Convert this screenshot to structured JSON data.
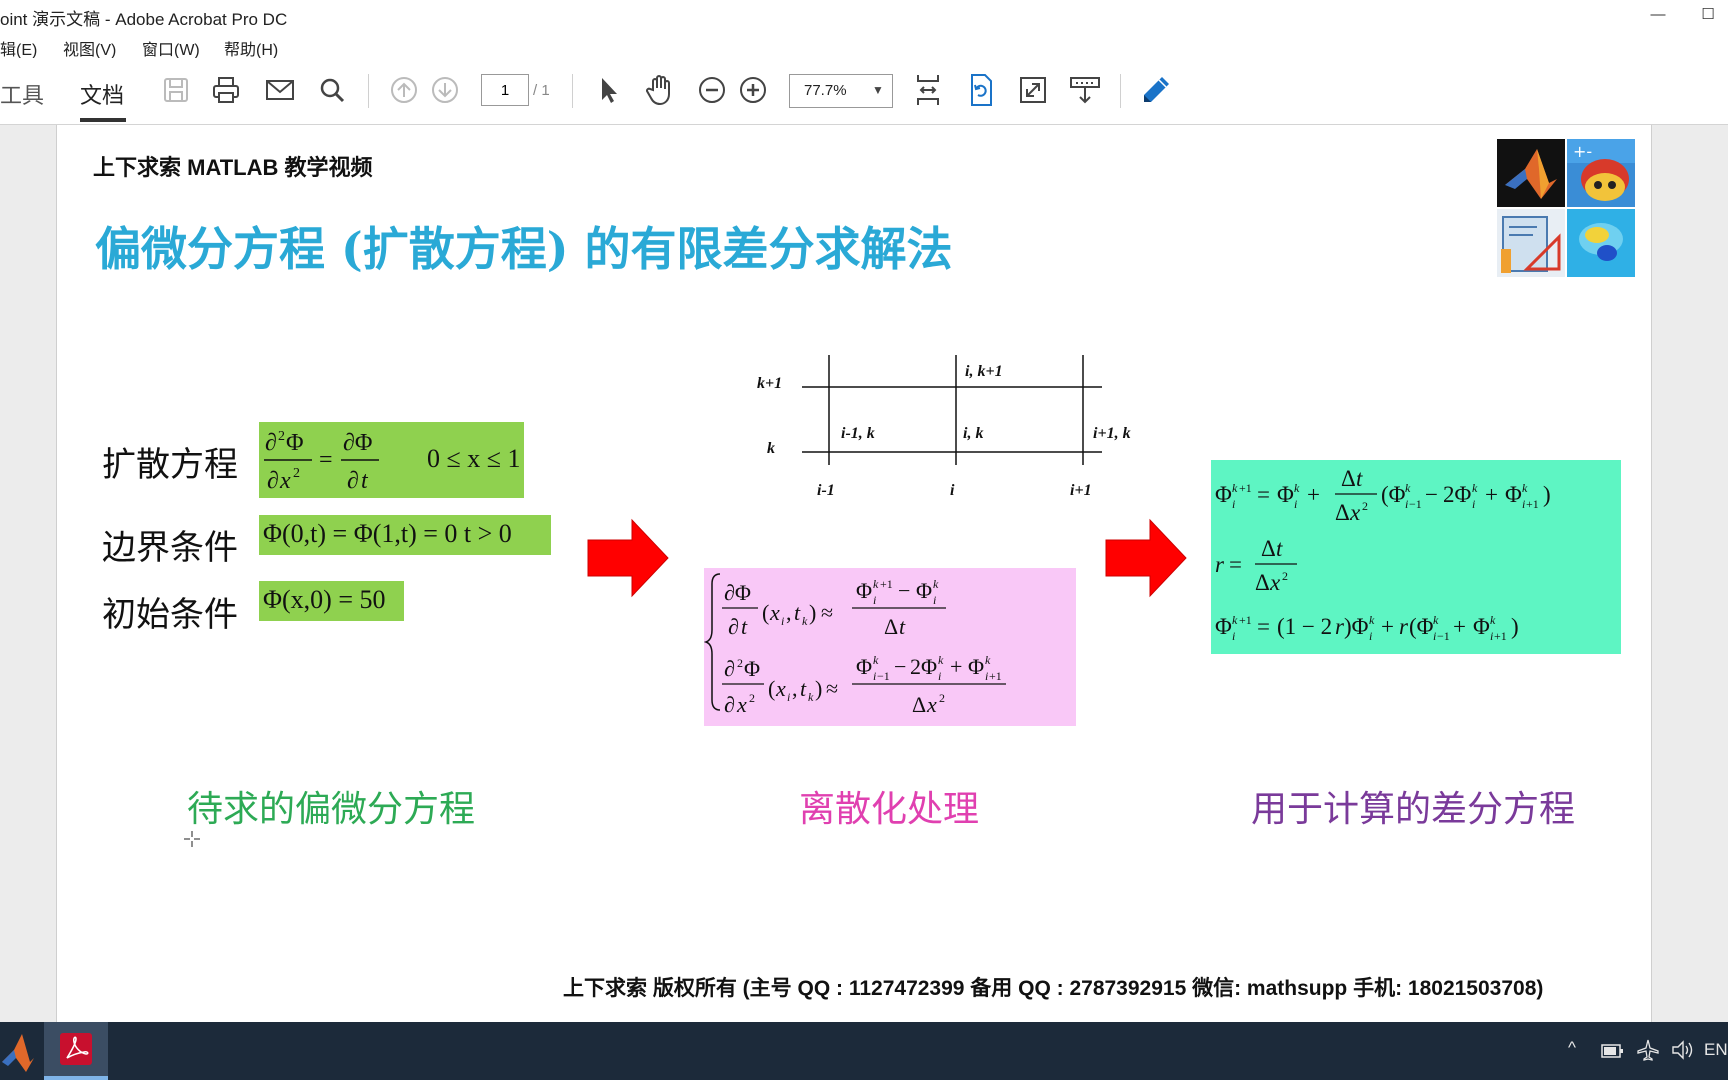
{
  "window": {
    "title": "oint 演示文稿 - Adobe Acrobat Pro DC",
    "controls": {
      "minimize": "—",
      "maximize": "☐"
    }
  },
  "menu": {
    "items": [
      "辑(E)",
      "视图(V)",
      "窗口(W)",
      "帮助(H)"
    ]
  },
  "toolbar": {
    "tabs": {
      "tools": "工具",
      "document": "文档"
    },
    "page_number": "1",
    "page_total": "/ 1",
    "zoom": "77.7%",
    "icons": [
      "save-icon",
      "print-icon",
      "mail-icon",
      "search-icon",
      "page-up-icon",
      "page-down-icon",
      "select-cursor-icon",
      "hand-icon",
      "zoom-out-icon",
      "zoom-in-icon",
      "fit-page-icon",
      "rotate-page-icon",
      "fullscreen-icon",
      "read-mode-icon",
      "sign-pen-icon"
    ]
  },
  "slide": {
    "header": "上下求索 MATLAB 教学视频",
    "title": "偏微分方程 (扩散方程) 的有限差分求解法",
    "labels": {
      "diffusion": "扩散方程",
      "boundary": "边界条件",
      "initial": "初始条件"
    },
    "equations": {
      "domain": "0 ≤ x ≤ 1",
      "boundary": "Φ(0,t) = Φ(1,t) = 0   t > 0",
      "initial": "Φ(x,0) = 50"
    },
    "grid": {
      "row_labels": [
        "k+1",
        "k"
      ],
      "col_labels": [
        "i-1",
        "i",
        "i+1"
      ],
      "node_labels": [
        "i, k+1",
        "i-1, k",
        "i, k",
        "i+1, k"
      ]
    },
    "captions": {
      "left": "待求的偏微分方程",
      "middle": "离散化处理",
      "right": "用于计算的差分方程"
    },
    "footer": "上下求索  版权所有  (主号 QQ : 1127472399   备用 QQ : 2787392915   微信: mathsupp   手机: 18021503708)",
    "colors": {
      "title": "#2aa9d6",
      "green_box": "#8fd14f",
      "pink_box": "#f9c8f7",
      "teal_box": "#5ef5c3",
      "arrow": "#ff0000",
      "caption_left": "#2daa55",
      "caption_middle": "#e040b0",
      "caption_right": "#7a3a9a"
    }
  },
  "taskbar": {
    "apps": [
      "matlab-icon",
      "acrobat-icon"
    ],
    "tray": {
      "language": "EN"
    }
  }
}
